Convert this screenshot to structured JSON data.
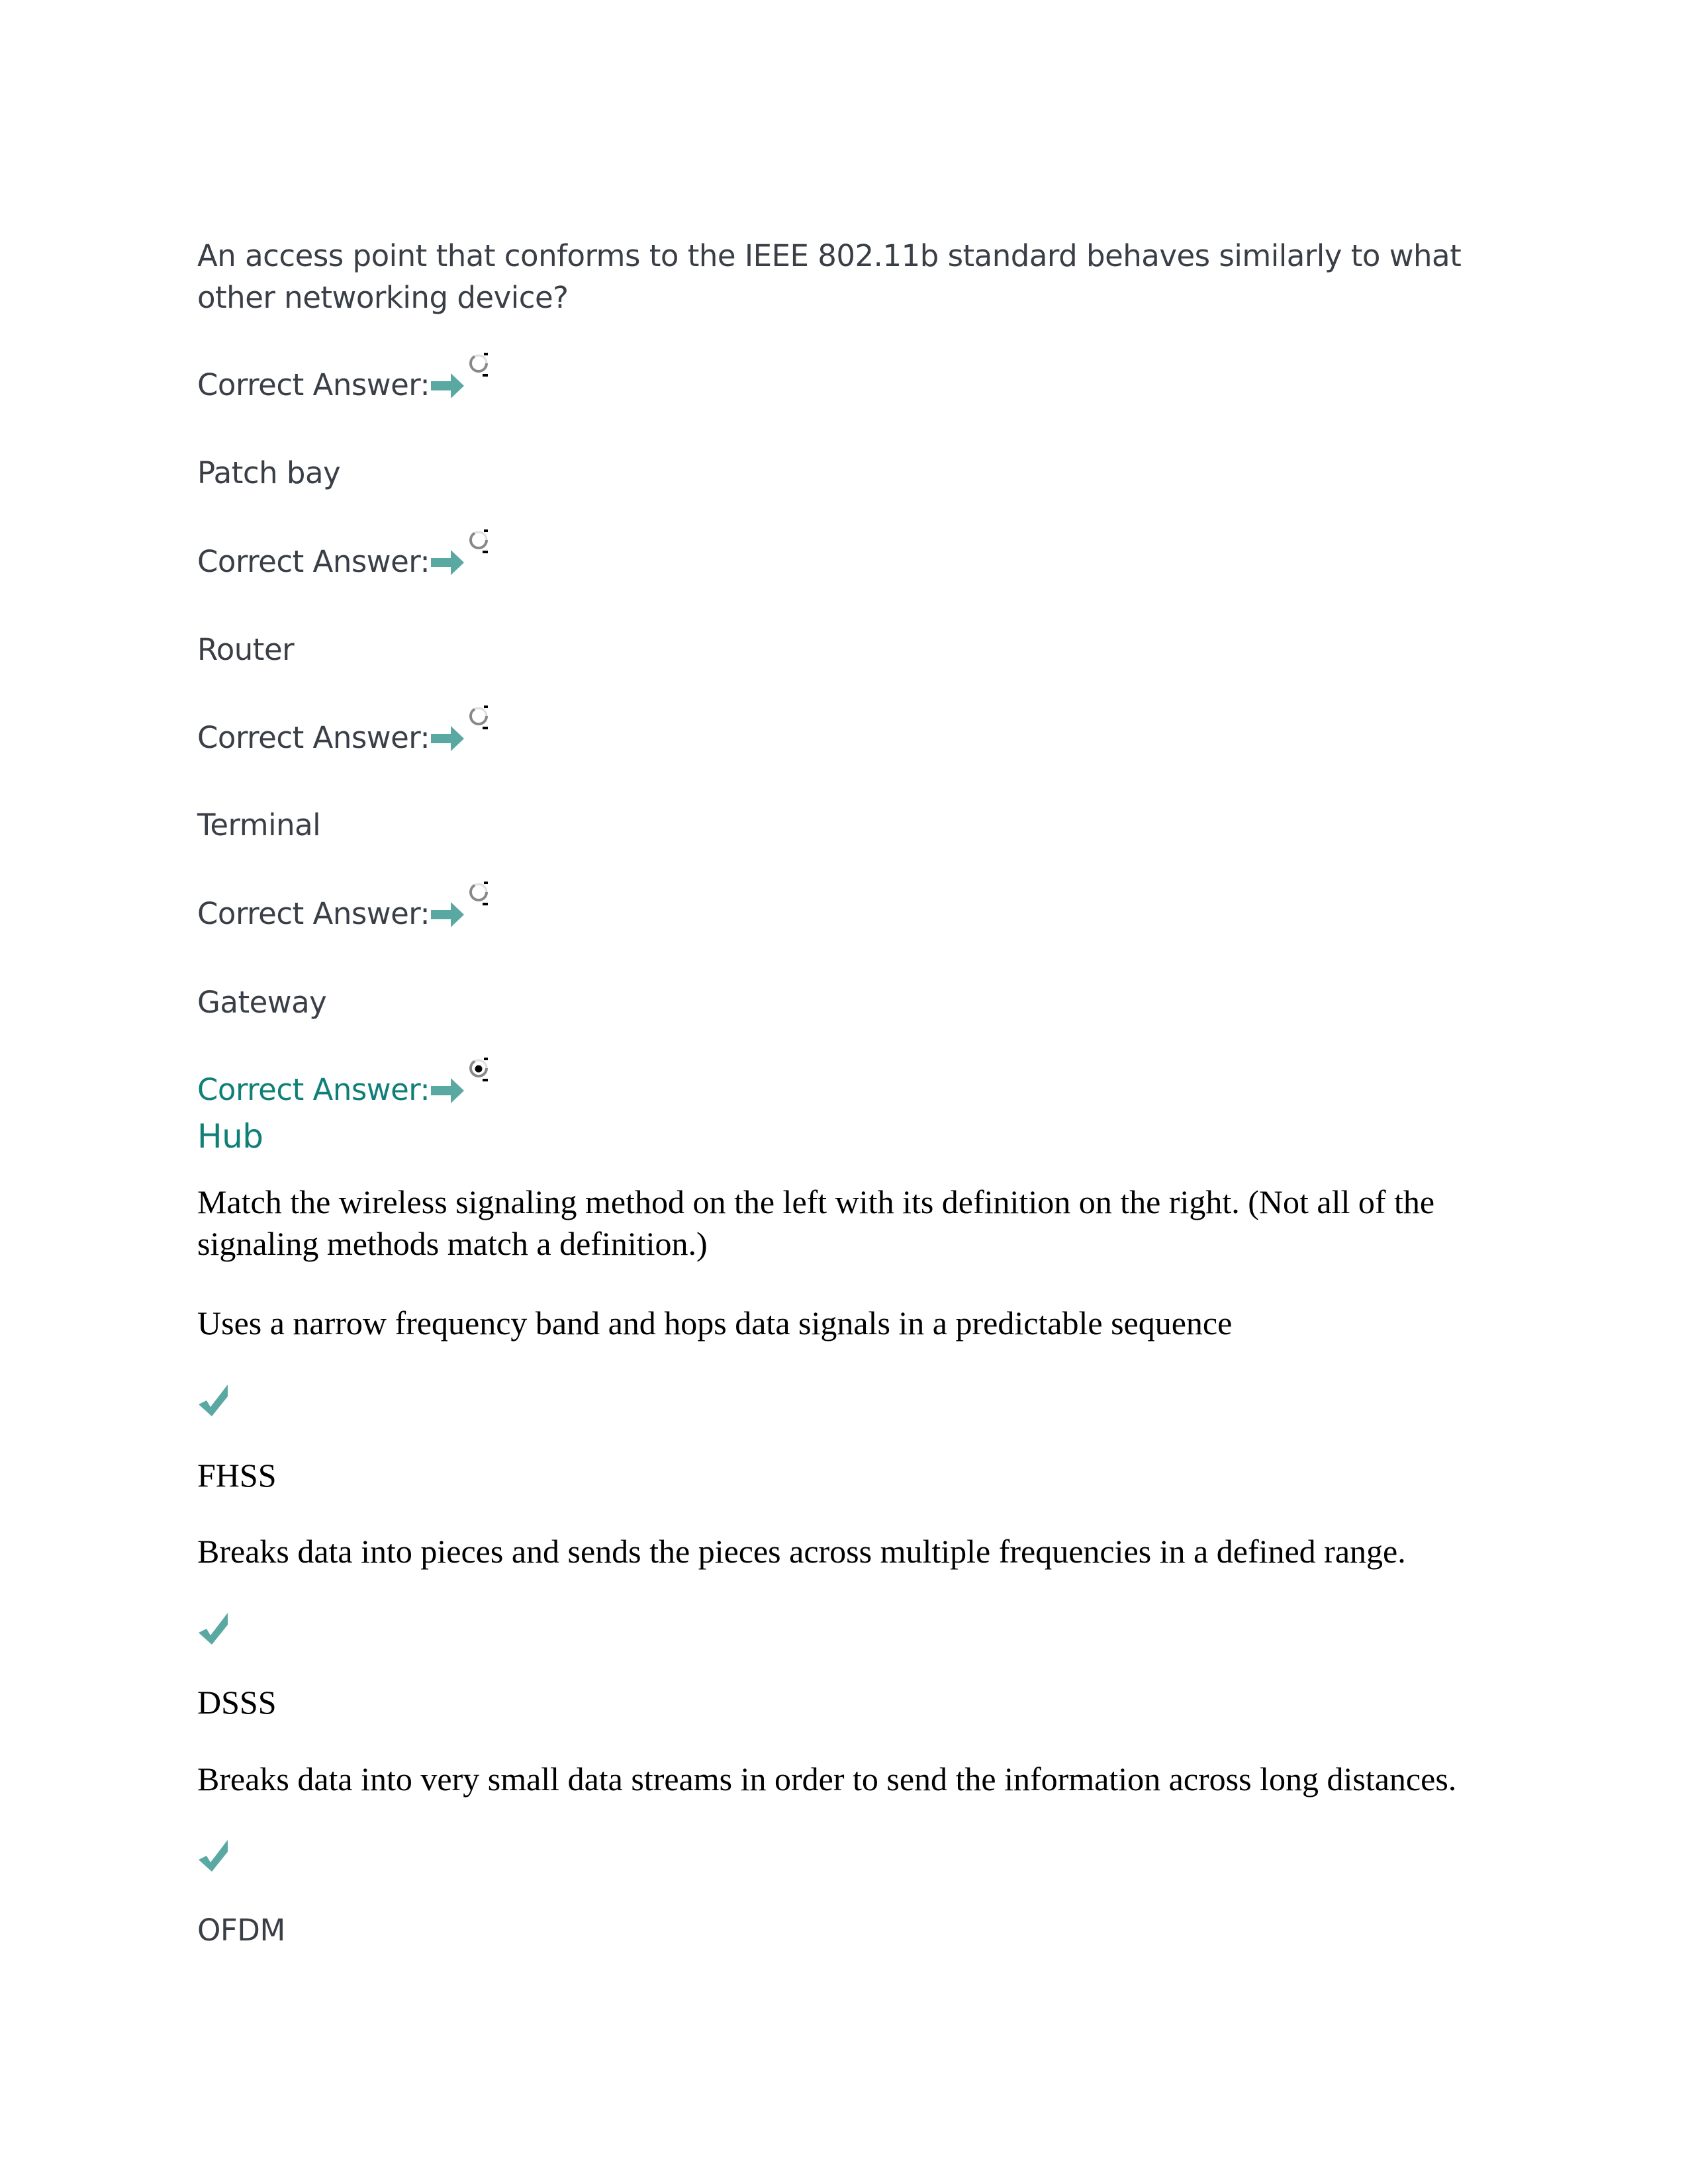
{
  "question1": {
    "text": "An access point that conforms to the IEEE 802.11b standard behaves similarly to what other networking device?",
    "correct_label": "Correct Answer:",
    "options": [
      {
        "label": "Patch bay",
        "selected": false
      },
      {
        "label": "Router",
        "selected": false
      },
      {
        "label": "Terminal",
        "selected": false
      },
      {
        "label": "Gateway",
        "selected": false
      },
      {
        "label": "Hub",
        "selected": true
      }
    ]
  },
  "question2": {
    "text": "Match the wireless signaling method on the left with its definition on the right. (Not all of the signaling methods match a definition.)",
    "pairs": [
      {
        "definition": "Uses a narrow frequency band and hops data signals in a predictable sequence",
        "answer": "FHSS"
      },
      {
        "definition": "Breaks data into pieces and sends the pieces across multiple frequencies in a defined range.",
        "answer": "DSSS"
      },
      {
        "definition": "Breaks data into very small data streams in order to send the information across long distances.",
        "answer": "OFDM"
      }
    ]
  },
  "colors": {
    "accent": "#5aa8a2",
    "correct_text": "#0f7f77",
    "body_text": "#3a3f47"
  }
}
